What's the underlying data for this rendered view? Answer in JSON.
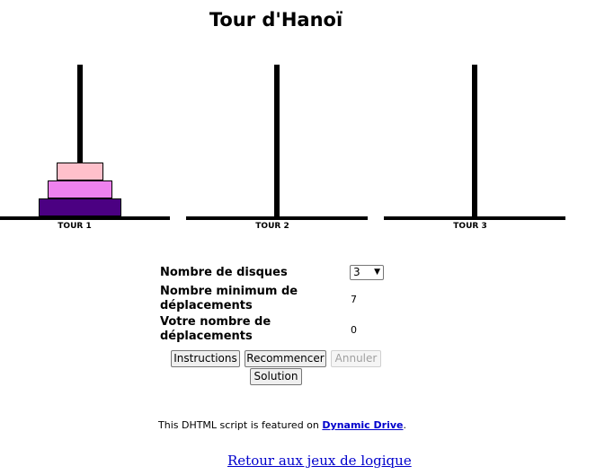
{
  "title": "Tour d'Hanoï",
  "towers": [
    {
      "label": "TOUR 1",
      "disks": [
        3,
        2,
        1
      ]
    },
    {
      "label": "TOUR 2",
      "disks": []
    },
    {
      "label": "TOUR 3",
      "disks": []
    }
  ],
  "disk_colors": {
    "1": "#ffc0cb",
    "2": "#ee82ee",
    "3": "#4b0082"
  },
  "controls": {
    "num_disks_label": "Nombre de disques",
    "num_disks_value": "3",
    "min_moves_label": "Nombre minimum de déplacements",
    "min_moves_value": "7",
    "your_moves_label": "Votre nombre de déplacements",
    "your_moves_value": "0"
  },
  "buttons": {
    "instructions": "Instructions",
    "restart": "Recommencer",
    "undo": "Annuler",
    "solution": "Solution"
  },
  "footer": {
    "featured_prefix": "This DHTML script is featured on ",
    "featured_link": "Dynamic Drive",
    "featured_suffix": ".",
    "back_link": "Retour aux jeux de logique"
  }
}
